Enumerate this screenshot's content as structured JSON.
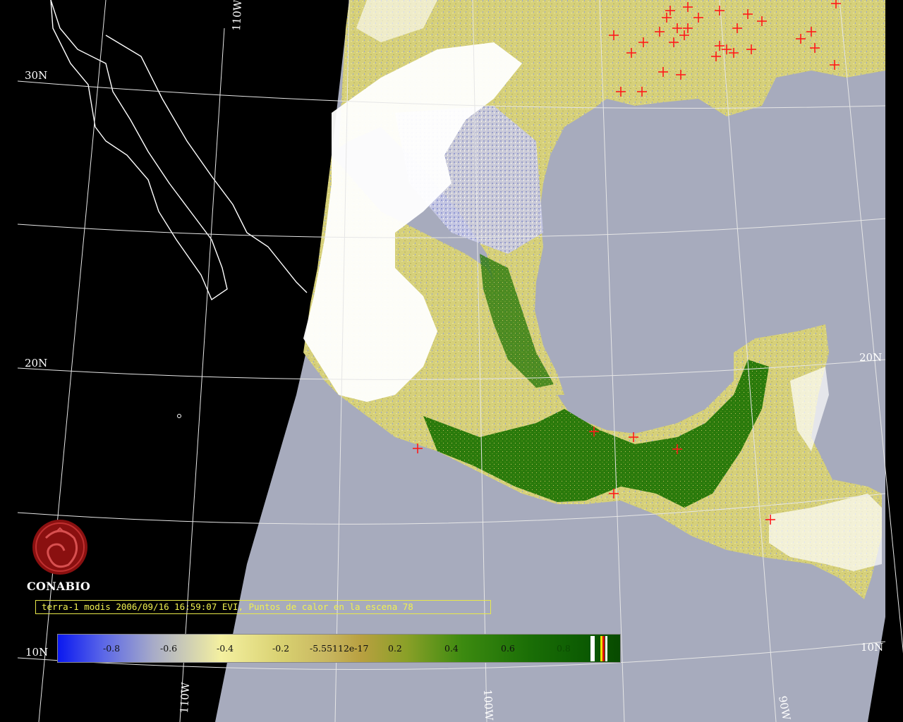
{
  "brand": {
    "name": "CONABIO"
  },
  "caption": "terra-1 modis 2006/09/16 16:59:07 EVI, Puntos de calor en la escena 78",
  "grid_labels": {
    "lat_30n": "30N",
    "lat_20n_left": "20N",
    "lat_20n_right": "20N",
    "lat_10n_left": "10N",
    "lat_10n_right": "10N",
    "lon_110w_top": "110W",
    "lon_110w_bottom": "110W",
    "lon_100w": "100W",
    "lon_90w": "90W"
  },
  "legend": {
    "ticks": [
      "-0.8",
      "-0.6",
      "-0.4",
      "-0.2",
      "-5.55112e-17",
      "0.2",
      "0.4",
      "0.6",
      "0.8"
    ],
    "scale_min": -1.0,
    "scale_max": 1.0
  },
  "colors": {
    "ocean": "#a7abbd",
    "cloud": "#ffffff",
    "veg_low": "#d8d27a",
    "veg_mid": "#8ea02a",
    "veg_high": "#1f6e08",
    "hotspot": "#ff1a1a",
    "caption": "#f0f050"
  }
}
